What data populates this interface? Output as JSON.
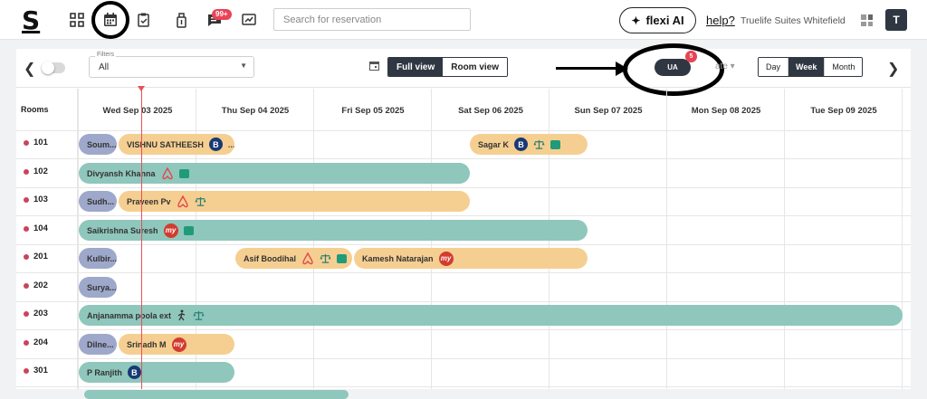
{
  "brand": {
    "logo": "S"
  },
  "nav": {
    "notifications_badge": "99+",
    "search_placeholder": "Search for reservation",
    "flexi_label": "flexi AI",
    "help_label": "help?",
    "property_name": "Truelife Suites Whitefield",
    "avatar_initial": "T"
  },
  "toolbar": {
    "filter_label": "Filters",
    "filter_value": "All",
    "full_view": "Full view",
    "room_view": "Room view",
    "ua_label": "UA",
    "ua_count": "5",
    "date_label": "ate",
    "ranges": [
      "Day",
      "Week",
      "Month"
    ],
    "active_range": "Week"
  },
  "grid": {
    "rooms_header": "Rooms",
    "dates": [
      "Wed Sep 03 2025",
      "Thu Sep 04 2025",
      "Fri Sep 05 2025",
      "Sat Sep 06 2025",
      "Sun Sep 07 2025",
      "Mon Sep 08 2025",
      "Tue Sep 09 2025"
    ],
    "rooms": [
      "101",
      "102",
      "103",
      "104",
      "201",
      "202",
      "203",
      "204",
      "301"
    ]
  },
  "reservations": {
    "r101a": "Soum...",
    "r101b": "VISHNU SATHEESH",
    "r101b_more": "...",
    "r101c": "Sagar K",
    "r102": "Divyansh Khanna",
    "r103a": "Sudh...",
    "r103b": "Praveen Pv",
    "r104": "Saikrishna Suresh",
    "r201a": "Kulbir...",
    "r201b": "Asif Boodihal",
    "r201c": "Kamesh Natarajan",
    "r202": "Surya...",
    "r203": "Anjanamma poola ext",
    "r204a": "Dilne...",
    "r204b": "Srinadh M",
    "r301": "P Ranjith"
  },
  "icons": {
    "booking": "B",
    "mmt": "my"
  },
  "colors": {
    "dark": "#2f3742",
    "teal_bar": "#8fc7bc",
    "orange_bar": "#f5cf91",
    "lavender_bar": "#9ea8cb",
    "badge_red": "#e84355"
  }
}
